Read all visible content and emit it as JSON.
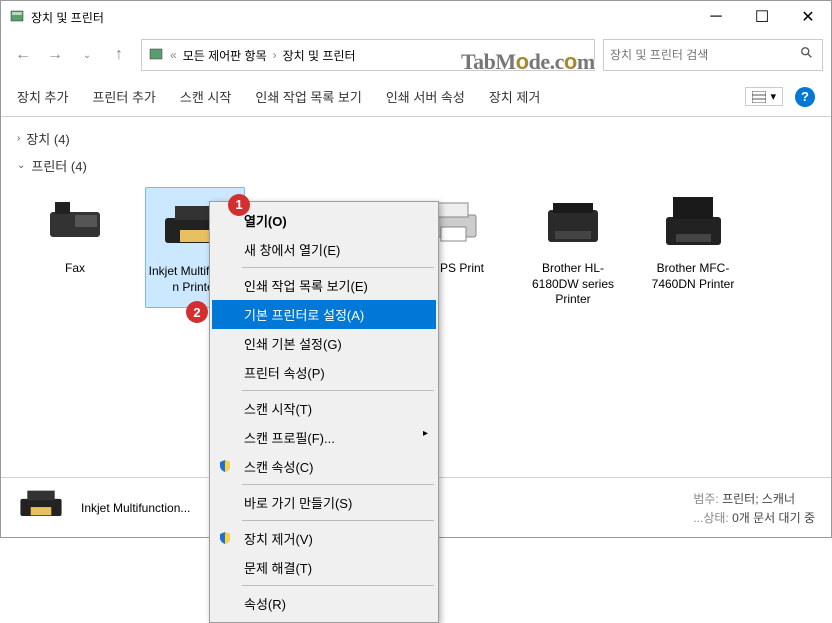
{
  "window": {
    "title": "장치 및 프린터"
  },
  "breadcrumb": {
    "root_icon": "control-panel",
    "items": [
      "모든 제어판 항목",
      "장치 및 프린터"
    ]
  },
  "search": {
    "placeholder": "장치 및 프린터 검색"
  },
  "toolbar": {
    "add_device": "장치 추가",
    "add_printer": "프린터 추가",
    "start_scan": "스캔 시작",
    "view_queue": "인쇄 작업 목록 보기",
    "server_props": "인쇄 서버 속성",
    "remove_device": "장치 제거"
  },
  "sections": {
    "devices": "장치 (4)",
    "printers": "프린터 (4)"
  },
  "printers": [
    {
      "name": "Fax"
    },
    {
      "name": "Inkjet Multifunction Printer"
    },
    {
      "name": "Adobe PS Print"
    },
    {
      "name": "Brother HL-6180DW series Printer"
    },
    {
      "name": "Brother MFC-7460DN Printer"
    }
  ],
  "context_menu": {
    "open": "열기(O)",
    "open_new_window": "새 창에서 열기(E)",
    "view_queue": "인쇄 작업 목록 보기(E)",
    "set_default": "기본 프린터로 설정(A)",
    "print_defaults": "인쇄 기본 설정(G)",
    "printer_props": "프린터 속성(P)",
    "start_scan": "스캔 시작(T)",
    "scan_profile": "스캔 프로필(F)...",
    "scan_props": "스캔 속성(C)",
    "create_shortcut": "바로 가기 만들기(S)",
    "remove_device": "장치 제거(V)",
    "troubleshoot": "문제 해결(T)",
    "properties": "속성(R)"
  },
  "statusbar": {
    "title": "Inkjet Multifunction...",
    "category_label": "범주:",
    "category_value": "프린터; 스캐너",
    "status_label": "...상태:",
    "status_value": "0개 문서 대기 중"
  },
  "watermark": "TabMode.com"
}
